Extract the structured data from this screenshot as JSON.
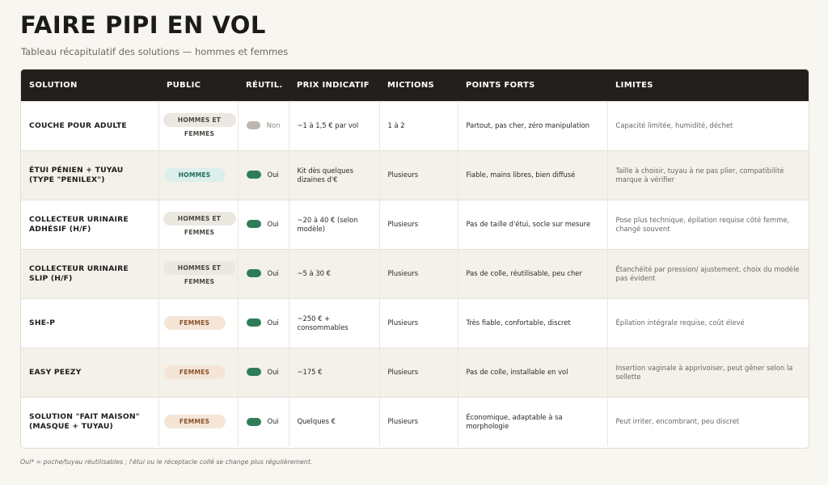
{
  "title": "FAIRE PIPI EN VOL",
  "subtitle": "Tableau récapitulatif des solutions — hommes et femmes",
  "colors": {
    "header_bg": "#231f1c",
    "yes_dot": "#2e7d57",
    "no_dot": "#bbb7ae",
    "badge_hommes": "#dcefec",
    "badge_femmes": "#f4e5d7",
    "badge_mixte": "#ebe8e2"
  },
  "table": {
    "headers": [
      "SOLUTION",
      "PUBLIC",
      "RÉUTIL.",
      "PRIX INDICATIF",
      "MICTIONS",
      "POINTS FORTS",
      "LIMITES"
    ],
    "rows": [
      {
        "solution": "COUCHE POUR ADULTE",
        "public": "HOMMES ET FEMMES",
        "reutil": "Non",
        "prix": "~1 à 1,5 € par vol",
        "mictions": "1 à 2",
        "points_forts": "Partout, pas cher, zéro manipulation",
        "limites": "Capacité limitée, humidité, déchet"
      },
      {
        "solution": "ÉTUI PÉNIEN + TUYAU (TYPE \"PENILEX\")",
        "public": "HOMMES",
        "reutil": "Oui",
        "prix": "Kit dès quelques dizaines d'€",
        "mictions": "Plusieurs",
        "points_forts": "Fiable, mains libres, bien diffusé",
        "limites": "Taille à choisir, tuyau à ne pas plier, compatibilité marque à vérifier"
      },
      {
        "solution": "COLLECTEUR URINAIRE ADHÉSIF (H/F)",
        "public": "HOMMES ET FEMMES",
        "reutil": "Oui",
        "prix": "~20 à 40 € (selon modèle)",
        "mictions": "Plusieurs",
        "points_forts": "Pas de taille d'étui, socle sur mesure",
        "limites": "Pose plus technique, épilation requise côté femme, changé souvent"
      },
      {
        "solution": "COLLECTEUR URINAIRE SLIP (H/F)",
        "public": "HOMMES ET FEMMES",
        "reutil": "Oui",
        "prix": "~5 à 30 €",
        "mictions": "Plusieurs",
        "points_forts": "Pas de colle, réutilisable, peu cher",
        "limites": "Étanchéité par pression/ ajustement, choix du modèle pas évident"
      },
      {
        "solution": "SHE-P",
        "public": "FEMMES",
        "reutil": "Oui",
        "prix": "~250 € + consommables",
        "mictions": "Plusieurs",
        "points_forts": "Très fiable, confortable, discret",
        "limites": "Épilation intégrale requise, coût élevé"
      },
      {
        "solution": "EASY PEEZY",
        "public": "FEMMES",
        "reutil": "Oui",
        "prix": "~175 €",
        "mictions": "Plusieurs",
        "points_forts": "Pas de colle, installable en vol",
        "limites": "Insertion vaginale à apprivoiser, peut gêner selon la sellette"
      },
      {
        "solution": "SOLUTION \"FAIT MAISON\" (MASQUE + TUYAU)",
        "public": "FEMMES",
        "reutil": "Oui",
        "prix": "Quelques €",
        "mictions": "Plusieurs",
        "points_forts": "Économique, adaptable à sa morphologie",
        "limites": "Peut irriter, encombrant, peu discret"
      }
    ]
  },
  "footnote": "Oui* = poche/tuyau réutilisables ; l'étui ou le réceptacle collé se change plus régulièrement."
}
